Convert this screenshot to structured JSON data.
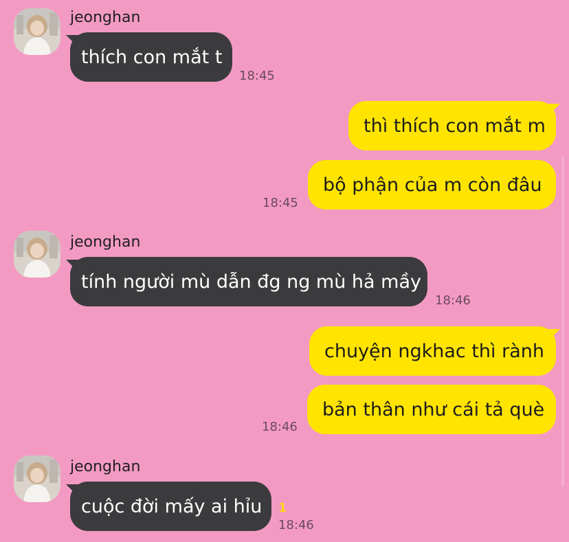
{
  "chat": {
    "sender_name": "jeonghan",
    "messages": [
      {
        "dir": "in",
        "text": "thích con mắt t",
        "time": "18:45"
      },
      {
        "dir": "out",
        "text": "thì thích con mắt m"
      },
      {
        "dir": "out",
        "text": "bộ phận của m còn đâu",
        "time": "18:45"
      },
      {
        "dir": "in",
        "text": "tính người mù dẫn đg ng mù hả mầy",
        "time": "18:46"
      },
      {
        "dir": "out",
        "text": "chuyện ngkhac thì rành"
      },
      {
        "dir": "out",
        "text": "bản thân như cái tả què",
        "time": "18:46"
      },
      {
        "dir": "in",
        "text": "cuộc đời mấy ai hỉu",
        "time": "18:46",
        "unread": "1"
      }
    ]
  },
  "colors": {
    "background": "#f39ac3",
    "incoming_bubble": "#3b3b3e",
    "outgoing_bubble": "#ffe400",
    "unread_count": "#ffd81a"
  },
  "icons": {
    "avatar": "profile-photo"
  }
}
